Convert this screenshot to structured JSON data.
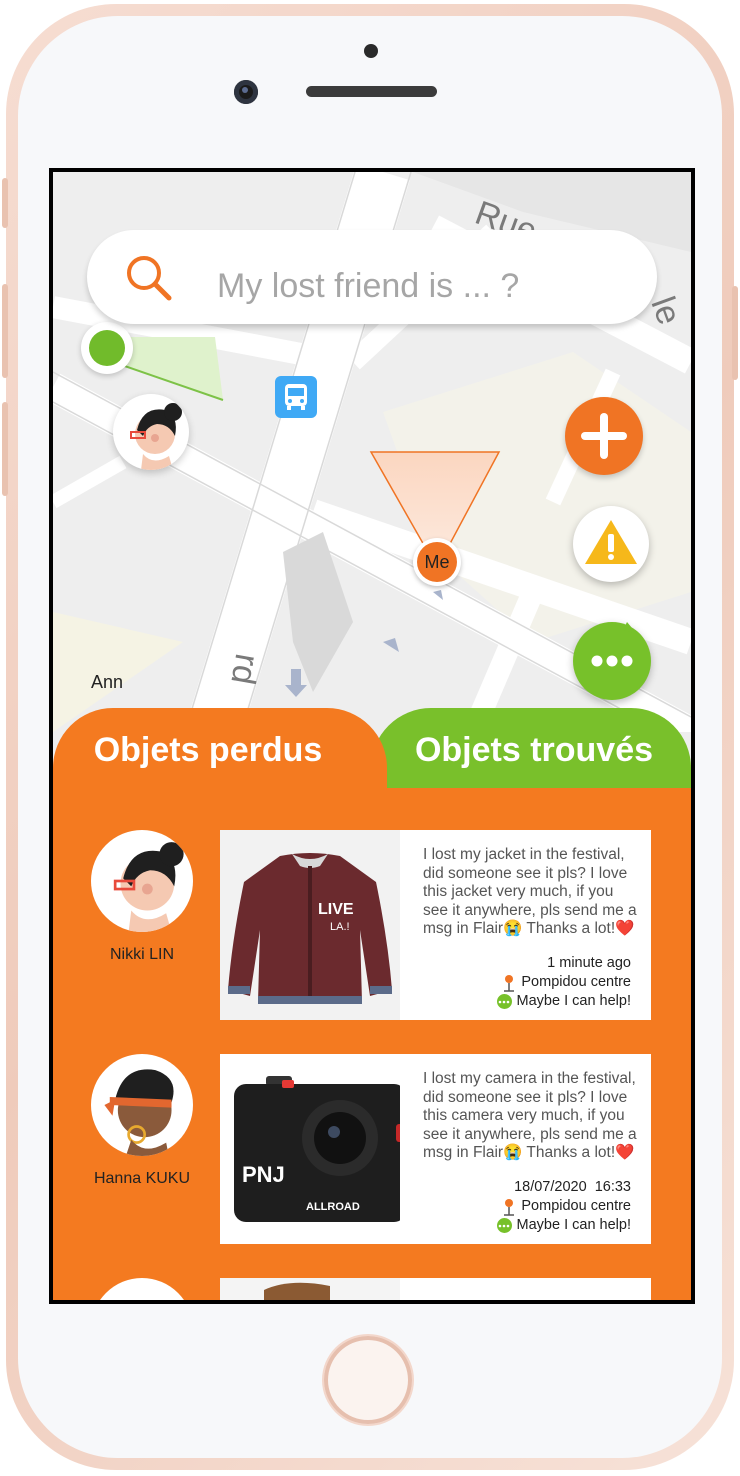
{
  "search": {
    "placeholder": "My lost friend is ... ?"
  },
  "map": {
    "me_label": "Me",
    "friend_label": "Ann"
  },
  "tabs": [
    {
      "label": "Objets perdus",
      "color": "#f47a20"
    },
    {
      "label": "Objets trouvés",
      "color": "#79c02b"
    }
  ],
  "posts": [
    {
      "name": "Nikki LIN",
      "text": "I lost my jacket in the festival, did someone see it pls? I love this jacket very much, if you see it anywhere, pls send me a msg in Flair😭 Thanks a lot!❤️",
      "time": "1 minute ago",
      "place": "Pompidou centre",
      "action": "Maybe I can help!"
    },
    {
      "name": "Hanna KUKU",
      "text": "I lost my camera in the festival, did someone see it pls? I love this camera very much, if you see it anywhere, pls send me a msg in Flair😭 Thanks a lot!❤️",
      "time": "18/07/2020  16:33",
      "place": "Pompidou centre",
      "action": "Maybe I can help!",
      "camera_brand": "PNJ",
      "camera_model": "ALLROAD"
    }
  ],
  "colors": {
    "accent": "#f47a20",
    "green": "#79c02b",
    "bus": "#3fa9f5"
  }
}
